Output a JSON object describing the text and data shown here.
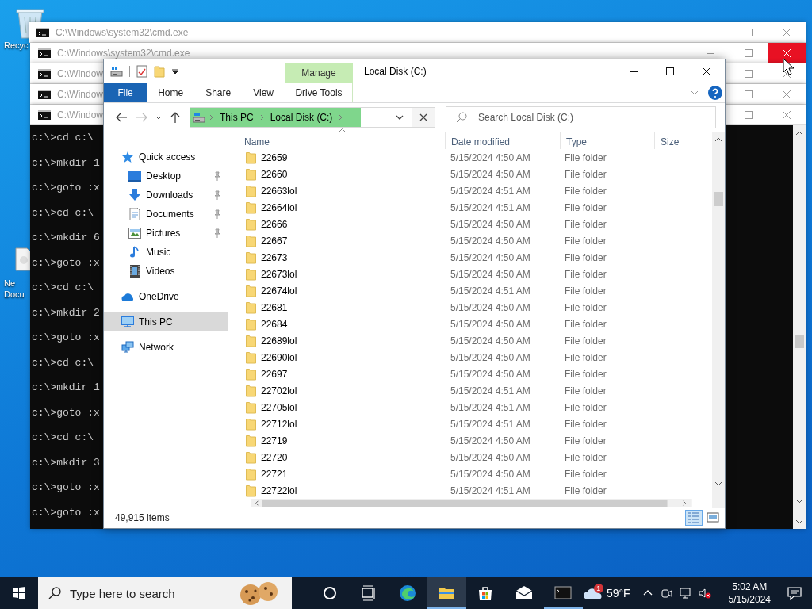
{
  "desktop_icons": [
    {
      "kind": "recycle_bin",
      "lines": [
        "Recyc"
      ]
    },
    {
      "kind": "document",
      "lines": [
        "Ne",
        "Docu"
      ]
    }
  ],
  "cmd_windows": [
    {
      "title": "C:\\Windows\\system32\\cmd.exe",
      "close_hovered": false
    },
    {
      "title": "C:\\Windows\\system32\\cmd.exe",
      "close_hovered": true
    },
    {
      "title": "C:\\Window",
      "close_hovered": false
    },
    {
      "title": "C:\\Window",
      "close_hovered": false
    },
    {
      "title": "C:\\Window",
      "close_hovered": false,
      "console_lines": [
        "c:\\>cd c:\\",
        "c:\\>mkdir 1",
        "c:\\>goto :x",
        "c:\\>cd c:\\",
        "c:\\>mkdir 6",
        "c:\\>goto :x",
        "c:\\>cd c:\\",
        "c:\\>mkdir 2",
        "c:\\>goto :x",
        "c:\\>cd c:\\",
        "c:\\>mkdir 1",
        "c:\\>goto :x",
        "c:\\>cd c:\\",
        "c:\\>mkdir 3",
        "c:\\>goto :x",
        "c:\\>goto :x"
      ]
    }
  ],
  "explorer": {
    "title": "Local Disk (C:)",
    "context_tab": {
      "group": "Manage",
      "tab": "Drive Tools"
    },
    "ribbon_tabs": [
      {
        "label": "File",
        "kind": "file"
      },
      {
        "label": "Home",
        "kind": "tab"
      },
      {
        "label": "Share",
        "kind": "tab"
      },
      {
        "label": "View",
        "kind": "tab"
      }
    ],
    "address": {
      "level": 0.77,
      "crumbs": [
        "This PC",
        "Local Disk (C:)"
      ]
    },
    "search": {
      "placeholder": "Search Local Disk (C:)"
    },
    "nav": [
      {
        "label": "Quick access",
        "kind": "quick_access",
        "selected": false,
        "children": [
          {
            "label": "Desktop",
            "kind": "desktop",
            "pinned": true,
            "selected": false
          },
          {
            "label": "Downloads",
            "kind": "downloads",
            "pinned": true,
            "selected": false
          },
          {
            "label": "Documents",
            "kind": "documents",
            "pinned": true,
            "selected": false
          },
          {
            "label": "Pictures",
            "kind": "pictures",
            "pinned": true,
            "selected": false
          },
          {
            "label": "Music",
            "kind": "music",
            "pinned": false,
            "selected": false
          },
          {
            "label": "Videos",
            "kind": "videos",
            "pinned": false,
            "selected": false
          }
        ]
      },
      {
        "label": "OneDrive",
        "kind": "onedrive",
        "selected": false
      },
      {
        "label": "This PC",
        "kind": "this_pc",
        "selected": true
      },
      {
        "label": "Network",
        "kind": "network",
        "selected": false
      }
    ],
    "columns": [
      {
        "label": "Name",
        "sorted": true
      },
      {
        "label": "Date modified",
        "sorted": false
      },
      {
        "label": "Type",
        "sorted": false
      },
      {
        "label": "Size",
        "sorted": false
      }
    ],
    "rows": [
      {
        "name": "22659",
        "date": "5/15/2024 4:50 AM",
        "type": "File folder"
      },
      {
        "name": "22660",
        "date": "5/15/2024 4:50 AM",
        "type": "File folder"
      },
      {
        "name": "22663lol",
        "date": "5/15/2024 4:51 AM",
        "type": "File folder"
      },
      {
        "name": "22664lol",
        "date": "5/15/2024 4:51 AM",
        "type": "File folder"
      },
      {
        "name": "22666",
        "date": "5/15/2024 4:50 AM",
        "type": "File folder"
      },
      {
        "name": "22667",
        "date": "5/15/2024 4:50 AM",
        "type": "File folder"
      },
      {
        "name": "22673",
        "date": "5/15/2024 4:50 AM",
        "type": "File folder"
      },
      {
        "name": "22673lol",
        "date": "5/15/2024 4:50 AM",
        "type": "File folder"
      },
      {
        "name": "22674lol",
        "date": "5/15/2024 4:51 AM",
        "type": "File folder"
      },
      {
        "name": "22681",
        "date": "5/15/2024 4:50 AM",
        "type": "File folder"
      },
      {
        "name": "22684",
        "date": "5/15/2024 4:50 AM",
        "type": "File folder"
      },
      {
        "name": "22689lol",
        "date": "5/15/2024 4:50 AM",
        "type": "File folder"
      },
      {
        "name": "22690lol",
        "date": "5/15/2024 4:50 AM",
        "type": "File folder"
      },
      {
        "name": "22697",
        "date": "5/15/2024 4:50 AM",
        "type": "File folder"
      },
      {
        "name": "22702lol",
        "date": "5/15/2024 4:51 AM",
        "type": "File folder"
      },
      {
        "name": "22705lol",
        "date": "5/15/2024 4:51 AM",
        "type": "File folder"
      },
      {
        "name": "22712lol",
        "date": "5/15/2024 4:51 AM",
        "type": "File folder"
      },
      {
        "name": "22719",
        "date": "5/15/2024 4:50 AM",
        "type": "File folder"
      },
      {
        "name": "22720",
        "date": "5/15/2024 4:50 AM",
        "type": "File folder"
      },
      {
        "name": "22721",
        "date": "5/15/2024 4:50 AM",
        "type": "File folder"
      },
      {
        "name": "22722lol",
        "date": "5/15/2024 4:51 AM",
        "type": "File folder"
      }
    ],
    "status": "49,915 items",
    "views": [
      {
        "kind": "details",
        "selected": true
      },
      {
        "kind": "large_icons",
        "selected": false
      }
    ]
  },
  "taskbar": {
    "search_placeholder": "Type here to search",
    "apps": [
      {
        "kind": "edge",
        "running": false,
        "active": false
      },
      {
        "kind": "explorer",
        "running": true,
        "active": true
      },
      {
        "kind": "store",
        "running": false,
        "active": false
      },
      {
        "kind": "mail",
        "running": false,
        "active": false
      },
      {
        "kind": "terminal",
        "running": true,
        "active": false
      }
    ],
    "weather": {
      "badge": "1",
      "temperature": "59°F"
    },
    "clock": {
      "time": "5:02 AM",
      "date": "5/15/2024"
    }
  }
}
